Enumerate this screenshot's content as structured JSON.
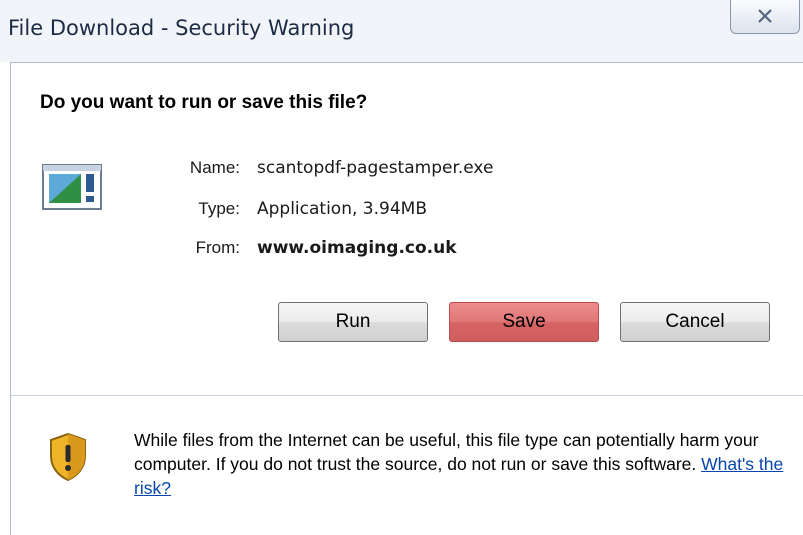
{
  "window": {
    "title": "File Download - Security Warning",
    "close_glyph": "☒"
  },
  "dialog": {
    "heading": "Do you want to run or save this file?",
    "file_icon": "application-window-icon",
    "fields": {
      "name_label": "Name:",
      "name_value": "scantopdf-pagestamper.exe",
      "type_label": "Type:",
      "type_value": "Application, 3.94MB",
      "from_label": "From:",
      "from_value": "www.oimaging.co.uk"
    },
    "buttons": {
      "run": "Run",
      "save": "Save",
      "cancel": "Cancel"
    }
  },
  "warning": {
    "icon": "shield-warning-icon",
    "text": "While files from the Internet can be useful, this file type can potentially harm your computer. If you do not trust the source, do not run or save this software.",
    "link_text": "What's the risk?"
  },
  "colors": {
    "save_button": "#e07878",
    "link": "#0645ad",
    "shield_gold": "#f0b429"
  }
}
